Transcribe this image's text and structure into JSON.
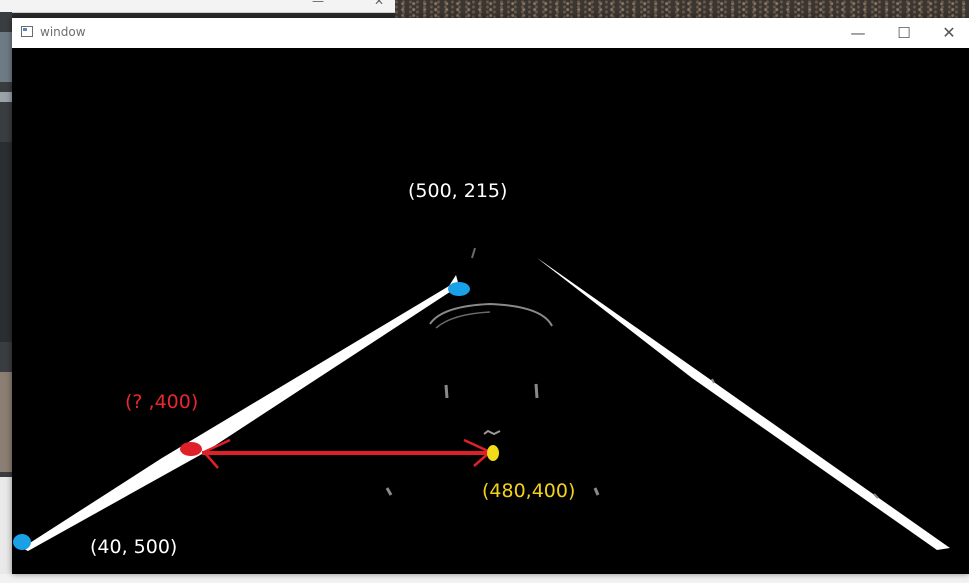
{
  "window": {
    "title": "window",
    "minimize_icon": "—",
    "maximize_icon": "☐",
    "close_icon": "✕"
  },
  "annotations": {
    "top_point": "(500, 215)",
    "bottom_left_point": "(40, 500)",
    "unknown_point": "(? ,400)",
    "target_point": "(480,400)"
  },
  "colors": {
    "lane_line": "#ffffff",
    "marker_blue": "#1aa0e6",
    "marker_red": "#e02028",
    "marker_yellow": "#f2dc18",
    "arrow_red": "#e02028",
    "canvas_bg": "#000000"
  },
  "icons": {
    "app": "window-app-icon",
    "minimize": "minimize-icon",
    "maximize": "maximize-icon",
    "close": "close-icon"
  }
}
